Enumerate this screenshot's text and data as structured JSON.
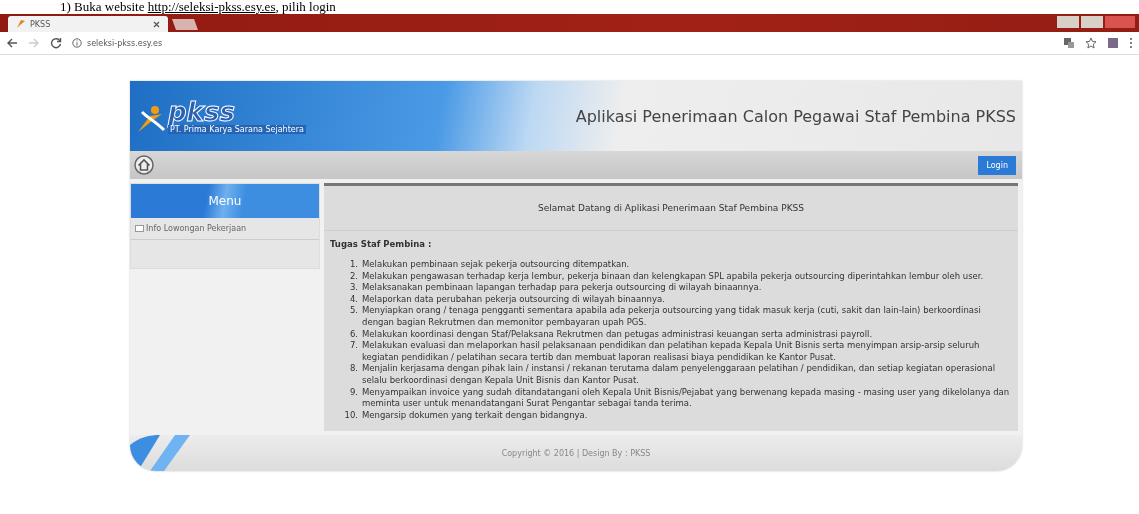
{
  "document_line": {
    "number": "1)",
    "before": "Buka website",
    "link": "http://seleksi-pkss.esy.es",
    "after": ", pilih login"
  },
  "browser": {
    "tab": {
      "title": "PKSS"
    },
    "address": "seleksi-pkss.esy.es"
  },
  "site": {
    "logo": {
      "name": "pkss",
      "company": "PT. Prima Karya Sarana Sejahtera"
    },
    "title": "Aplikasi Penerimaan Calon Pegawai Staf Pembina PKSS",
    "login_button": "Login",
    "menu": {
      "title": "Menu",
      "items": [
        {
          "label": "Info Lowongan Pekerjaan"
        }
      ]
    },
    "heading": "Selamat Datang di Aplikasi Penerimaan Staf Pembina PKSS",
    "section_title": "Tugas Staf Pembina :",
    "tasks": [
      {
        "number": "1.",
        "text": "Melakukan pembinaan sejak pekerja outsourcing ditempatkan."
      },
      {
        "number": "2.",
        "text": "Melakukan pengawasan terhadap kerja lembur, pekerja binaan dan kelengkapan SPL apabila pekerja outsourcing diperintahkan lembur oleh user."
      },
      {
        "number": "3.",
        "text": "Melaksanakan pembinaan lapangan terhadap para pekerja outsourcing di wilayah binaannya."
      },
      {
        "number": "4.",
        "text": "Melaporkan data perubahan pekerja outsourcing di wilayah binaannya."
      },
      {
        "number": "5.",
        "text": "Menyiapkan orang / tenaga pengganti sementara apabila ada pekerja outsourcing yang tidak masuk kerja (cuti, sakit dan lain-lain) berkoordinasi dengan bagian Rekrutmen dan memonitor pembayaran upah PGS."
      },
      {
        "number": "6.",
        "text": "Melakukan koordinasi dengan Staf/Pelaksana Rekrutmen dan petugas administrasi keuangan serta administrasi payroll."
      },
      {
        "number": "7.",
        "text": "Melakukan evaluasi dan melaporkan hasil pelaksanaan pendidikan dan pelatihan kepada Kepala Unit Bisnis serta menyimpan arsip-arsip seluruh kegiatan pendidikan / pelatihan secara tertib dan membuat laporan realisasi biaya pendidikan ke Kantor Pusat."
      },
      {
        "number": "8.",
        "text": "Menjalin kerjasama dengan pihak lain / instansi / rekanan terutama dalam penyelenggaraan pelatihan / pendidikan, dan setiap kegiatan operasional selalu berkoordinasi dengan Kepala Unit Bisnis dan Kantor Pusat."
      },
      {
        "number": "9.",
        "text": "Menyampaikan invoice yang sudah ditandatangani oleh Kepala Unit Bisnis/Pejabat yang berwenang kepada masing - masing user yang dikelolanya dan meminta user untuk menandatangani Surat Pengantar sebagai tanda terima."
      },
      {
        "number": "10.",
        "text": "Mengarsip dokumen yang terkait dengan bidangnya."
      }
    ],
    "footer": "Copyright © 2016 | Design By : PKSS"
  }
}
